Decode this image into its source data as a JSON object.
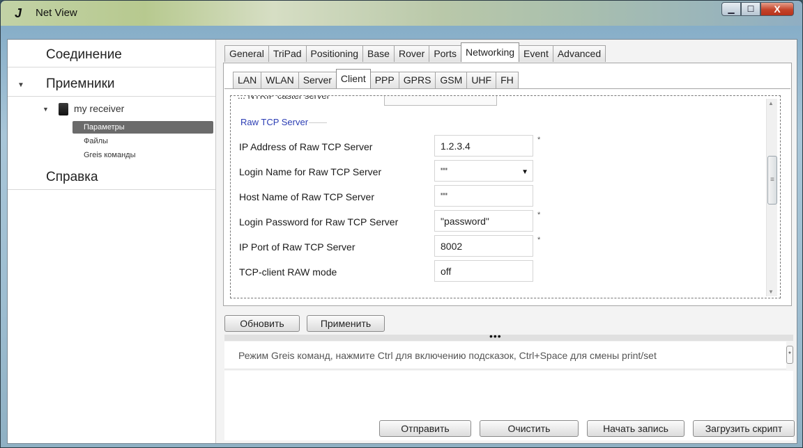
{
  "window": {
    "title": "Net View",
    "logo_glyph": "J",
    "buttons": {
      "minimize": "▁",
      "maximize": "☐",
      "close": "X"
    }
  },
  "sidebar": {
    "sections": [
      {
        "label": "Соединение"
      },
      {
        "label": "Приемники"
      },
      {
        "label": "Справка"
      }
    ],
    "receiver": {
      "name": "my receiver",
      "items": [
        {
          "label": "Параметры",
          "selected": true
        },
        {
          "label": "Файлы",
          "selected": false
        },
        {
          "label": "Greis команды",
          "selected": false
        }
      ]
    }
  },
  "main_tabs": [
    "General",
    "TriPad",
    "Positioning",
    "Base",
    "Rover",
    "Ports",
    "Networking",
    "Event",
    "Advanced"
  ],
  "main_tab_active": "Networking",
  "sub_tabs": [
    "LAN",
    "WLAN",
    "Server",
    "Client",
    "PPP",
    "GPRS",
    "GSM",
    "UHF",
    "FH"
  ],
  "sub_tab_active": "Client",
  "group": {
    "clipped_label": "... NTRIP caster server",
    "title": "Raw TCP Server",
    "fields": [
      {
        "label": "IP Address of Raw TCP Server",
        "value": "1.2.3.4",
        "required": true,
        "dropdown": false
      },
      {
        "label": "Login Name for Raw TCP Server",
        "value": "\"\"",
        "required": false,
        "dropdown": true
      },
      {
        "label": "Host Name of Raw TCP Server",
        "value": "\"\"",
        "required": false,
        "dropdown": false
      },
      {
        "label": "Login Password for Raw TCP Server",
        "value": "\"password\"",
        "required": true,
        "dropdown": false
      },
      {
        "label": "IP Port of Raw TCP Server",
        "value": "8002",
        "required": true,
        "dropdown": false
      },
      {
        "label": "TCP-client RAW mode",
        "value": "off",
        "required": false,
        "dropdown": false
      }
    ]
  },
  "actions": {
    "refresh": "Обновить",
    "apply": "Применить"
  },
  "splitter_dots": "•••",
  "hint": "Режим Greis команд, нажмите  Ctrl для включению подсказок, Ctrl+Space для смены print/set",
  "hint_expand": "*",
  "console_buttons": {
    "send": "Отправить",
    "clear": "Очистить",
    "start_record": "Начать запись",
    "load_script": "Загрузить скрипт"
  },
  "colors": {
    "group_title": "#2b3db4",
    "selected_item_bg": "#6b6b6b"
  }
}
